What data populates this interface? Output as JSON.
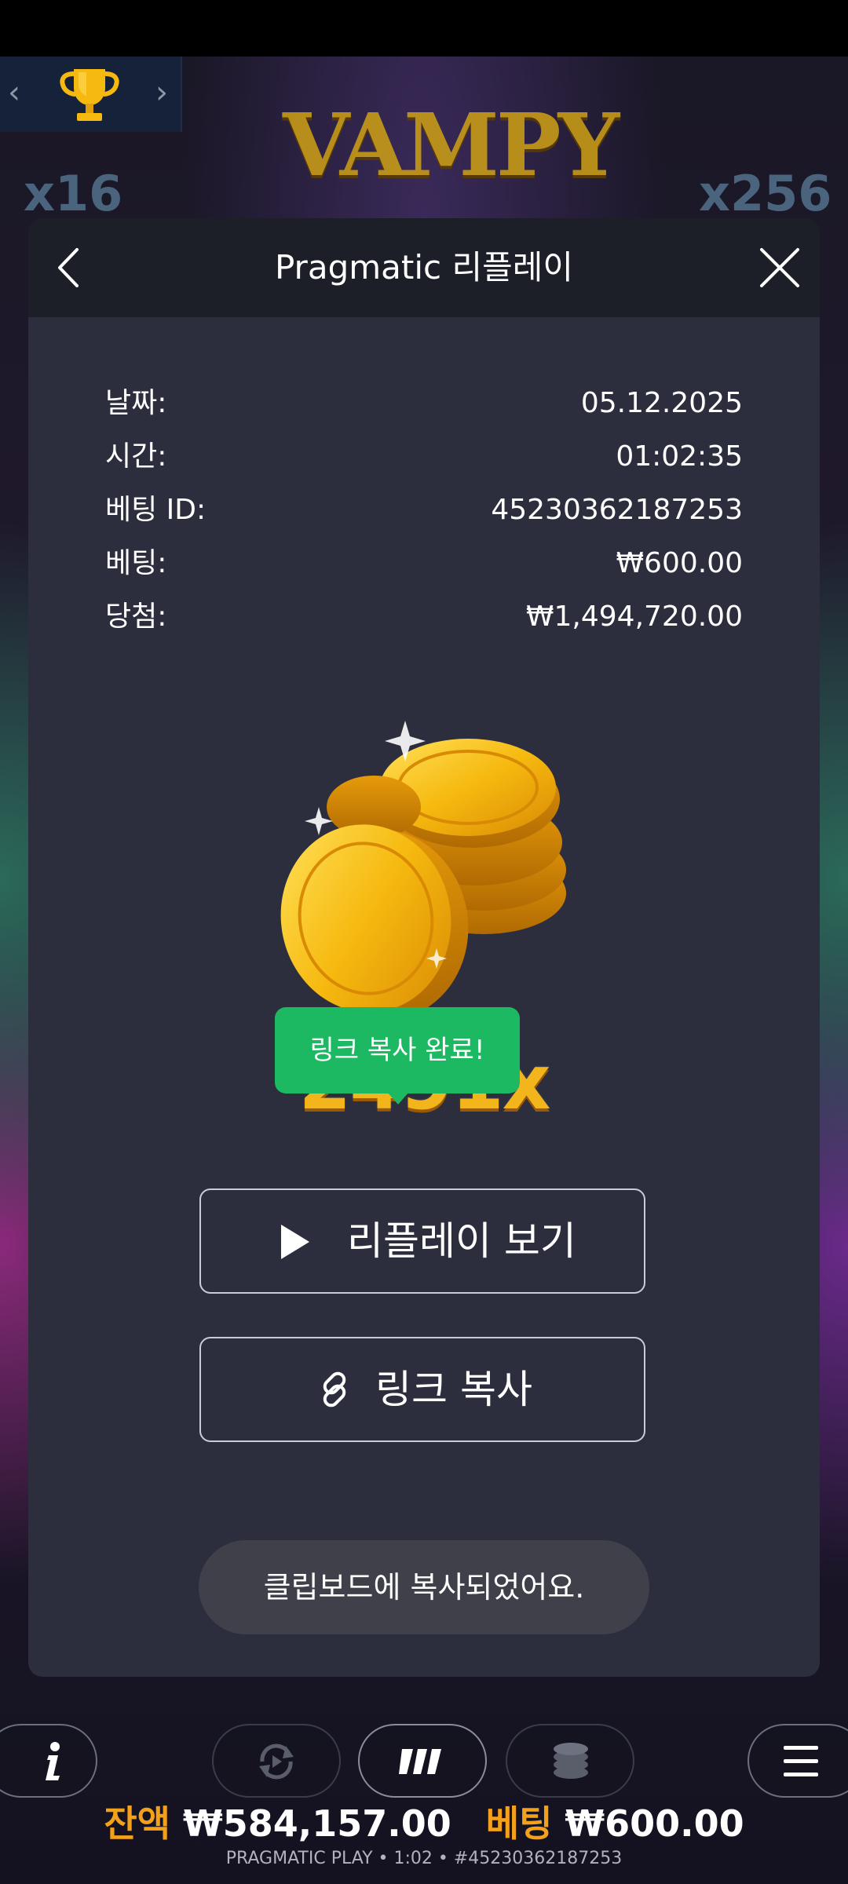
{
  "dialog": {
    "title": "Pragmatic 리플레이",
    "info": [
      {
        "label": "날짜:",
        "value": "05.12.2025"
      },
      {
        "label": "시간:",
        "value": "01:02:35"
      },
      {
        "label": "베팅 ID:",
        "value": "45230362187253"
      },
      {
        "label": "베팅:",
        "value": "₩600.00"
      },
      {
        "label": "당첨:",
        "value": "₩1,494,720.00"
      }
    ],
    "multiplier": "2491x",
    "replay_button_label": "리플레이 보기",
    "copy_link_button_label": "링크 복사",
    "tooltip": "링크 복사 완료!",
    "toast": "클립보드에 복사되었어요."
  },
  "background": {
    "logo_text": "VAMPY",
    "multiplier_left": "x16",
    "multiplier_right": "x256"
  },
  "bottom": {
    "balance_label": "잔액",
    "balance_value": "₩584,157.00",
    "bet_label": "베팅",
    "bet_value": "₩600.00",
    "footer": "PRAGMATIC PLAY • 1:02 • #45230362187253"
  },
  "icons": {
    "trophy": "trophy-icon",
    "back": "chevron-left-icon",
    "close": "close-icon",
    "play": "play-icon",
    "link": "link-icon",
    "info": "info-icon",
    "autoplay": "autoplay-icon",
    "turbo": "turbo-icon",
    "coins": "coins-icon",
    "menu": "menu-icon"
  },
  "colors": {
    "accent_orange": "#f3a11a",
    "tooltip_green": "#1cb862",
    "dialog_bg": "#2c2e3e",
    "header_bg": "#1c1e28"
  }
}
